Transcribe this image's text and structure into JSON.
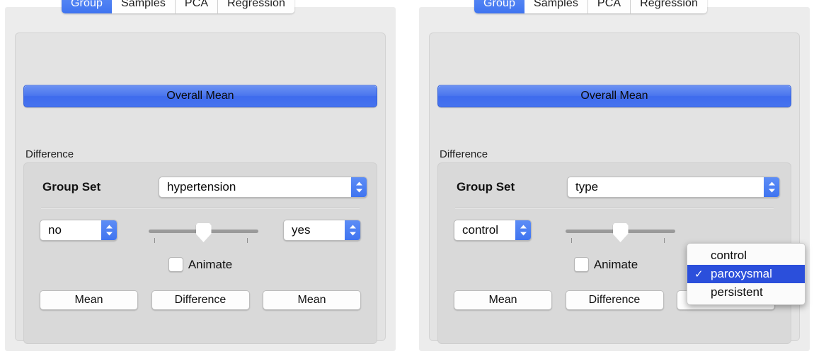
{
  "panels": [
    {
      "id": "left",
      "tabs": [
        {
          "label": "Group",
          "active": true
        },
        {
          "label": "Samples",
          "active": false
        },
        {
          "label": "PCA",
          "active": false
        },
        {
          "label": "Regression",
          "active": false
        }
      ],
      "overall_mean_label": "Overall Mean",
      "group_caption": "Difference",
      "group_set_label": "Group Set",
      "group_set_value": "hypertension",
      "left_value": "no",
      "right_value": "yes",
      "slider": {
        "position_percent": 50,
        "tick_count": 2
      },
      "animate_label": "Animate",
      "animate_checked": false,
      "buttons": [
        {
          "label": "Mean"
        },
        {
          "label": "Difference"
        },
        {
          "label": "Mean"
        }
      ],
      "menu_open": false
    },
    {
      "id": "right",
      "tabs": [
        {
          "label": "Group",
          "active": true
        },
        {
          "label": "Samples",
          "active": false
        },
        {
          "label": "PCA",
          "active": false
        },
        {
          "label": "Regression",
          "active": false
        }
      ],
      "overall_mean_label": "Overall Mean",
      "group_caption": "Difference",
      "group_set_label": "Group Set",
      "group_set_value": "type",
      "left_value": "control",
      "right_value": "",
      "slider": {
        "position_percent": 50,
        "tick_count": 2
      },
      "animate_label": "Animate",
      "animate_checked": false,
      "buttons": [
        {
          "label": "Mean"
        },
        {
          "label": "Difference"
        },
        {
          "label": "Mean"
        }
      ],
      "menu_open": true,
      "menu": {
        "items": [
          {
            "label": "control",
            "selected": false,
            "check": ""
          },
          {
            "label": "paroxysmal",
            "selected": true,
            "check": "✓"
          },
          {
            "label": "persistent",
            "selected": false,
            "check": ""
          }
        ]
      }
    }
  ],
  "colors": {
    "accent_blue": "#3f74f0",
    "menu_highlight": "#2b4fdb",
    "window_bg": "#ececec",
    "tabview_bg": "#e3e3e3",
    "groupbox_bg": "#d9d9d9",
    "control_white": "#ffffff",
    "slider_track": "#9a9a9a"
  }
}
